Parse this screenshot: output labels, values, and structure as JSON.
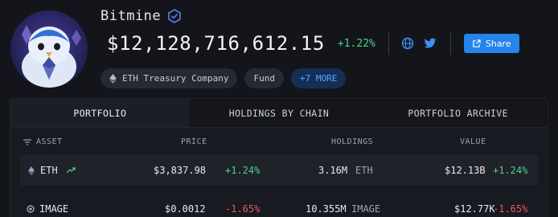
{
  "profile": {
    "name": "Bitmine",
    "balance": "$12,128,716,612.15",
    "balance_change": "+1.22%",
    "share_label": "Share",
    "tags": [
      "ETH Treasury Company",
      "Fund"
    ],
    "more_label": "+7 MORE"
  },
  "tabs": [
    {
      "label": "PORTFOLIO",
      "active": true
    },
    {
      "label": "HOLDINGS BY CHAIN",
      "active": false
    },
    {
      "label": "PORTFOLIO ARCHIVE",
      "active": false
    }
  ],
  "table": {
    "headers": {
      "asset": "ASSET",
      "price": "PRICE",
      "holdings": "HOLDINGS",
      "value": "VALUE"
    },
    "rows": [
      {
        "asset": "ETH",
        "price": "$3,837.98",
        "price_change": "+1.24%",
        "holdings": "3.16M",
        "holdings_unit": "ETH",
        "value": "$12.13B",
        "value_change": "+1.24%"
      },
      {
        "asset": "IMAGE",
        "price": "$0.0012",
        "price_change": "-1.65%",
        "holdings": "10.355M",
        "holdings_unit": "IMAGE",
        "value": "$12.77K",
        "value_change": "-1.65%"
      }
    ]
  },
  "colors": {
    "accent": "#2684ea",
    "positive": "#4fd18b",
    "negative": "#f0565e",
    "background": "#13151b"
  }
}
